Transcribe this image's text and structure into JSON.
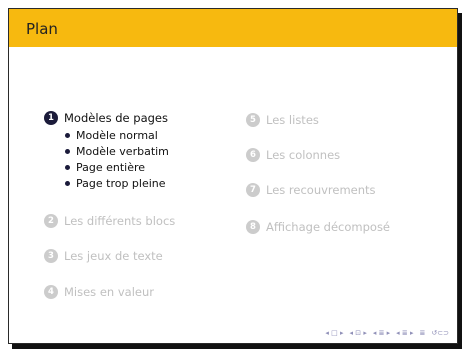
{
  "title": "Plan",
  "left_sections": [
    {
      "number": "1",
      "label": "Modèles de pages"
    },
    {
      "number": "2",
      "label": "Les différents blocs"
    },
    {
      "number": "3",
      "label": "Les jeux de texte"
    },
    {
      "number": "4",
      "label": "Mises en valeur"
    }
  ],
  "subsections": [
    "Modèle normal",
    "Modèle verbatim",
    "Page entière",
    "Page trop pleine"
  ],
  "right_sections": [
    {
      "number": "5",
      "label": "Les listes"
    },
    {
      "number": "6",
      "label": "Les colonnes"
    },
    {
      "number": "7",
      "label": "Les recouvrements"
    },
    {
      "number": "8",
      "label": "Affichage décomposé"
    }
  ],
  "nav": {
    "frame": "◂ □ ▸",
    "subsection": "◂ ⊡ ▸",
    "section_prev": "◂ ≣ ▸",
    "section_next": "◂ ≣ ▸",
    "align": "≣",
    "search": "↺⊂⊃"
  },
  "colors": {
    "titlebar": "#f7b90f",
    "active": "#1b1b3a",
    "inactive": "#c0c0c0"
  }
}
